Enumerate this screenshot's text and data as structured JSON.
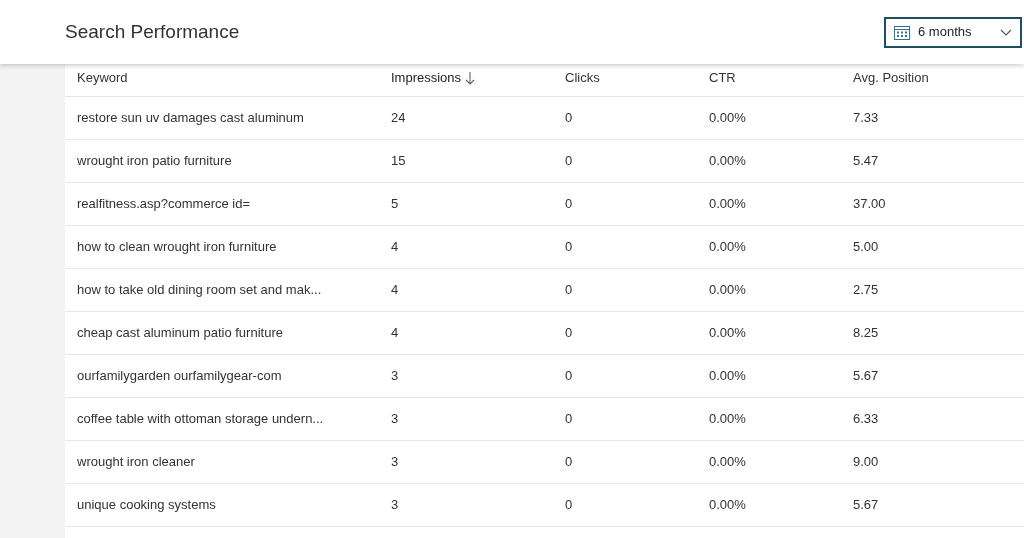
{
  "header": {
    "title": "Search Performance",
    "period": {
      "value": "6 months"
    }
  },
  "table": {
    "columns": [
      {
        "label": "Keyword",
        "sorted": false
      },
      {
        "label": "Impressions",
        "sorted": true
      },
      {
        "label": "Clicks",
        "sorted": false
      },
      {
        "label": "CTR",
        "sorted": false
      },
      {
        "label": "Avg. Position",
        "sorted": false
      }
    ],
    "rows": [
      [
        "restore sun uv damages cast aluminum",
        "24",
        "0",
        "0.00%",
        "7.33"
      ],
      [
        "wrought iron patio furniture",
        "15",
        "0",
        "0.00%",
        "5.47"
      ],
      [
        "realfitness.asp?commerce id=",
        "5",
        "0",
        "0.00%",
        "37.00"
      ],
      [
        "how to clean wrought iron furniture",
        "4",
        "0",
        "0.00%",
        "5.00"
      ],
      [
        "how to take old dining room set and mak...",
        "4",
        "0",
        "0.00%",
        "2.75"
      ],
      [
        "cheap cast aluminum patio furniture",
        "4",
        "0",
        "0.00%",
        "8.25"
      ],
      [
        "ourfamilygarden ourfamilygear-com",
        "3",
        "0",
        "0.00%",
        "5.67"
      ],
      [
        "coffee table with ottoman storage undern...",
        "3",
        "0",
        "0.00%",
        "6.33"
      ],
      [
        "wrought iron cleaner",
        "3",
        "0",
        "0.00%",
        "9.00"
      ],
      [
        "unique cooking systems",
        "3",
        "0",
        "0.00%",
        "5.67"
      ]
    ]
  }
}
